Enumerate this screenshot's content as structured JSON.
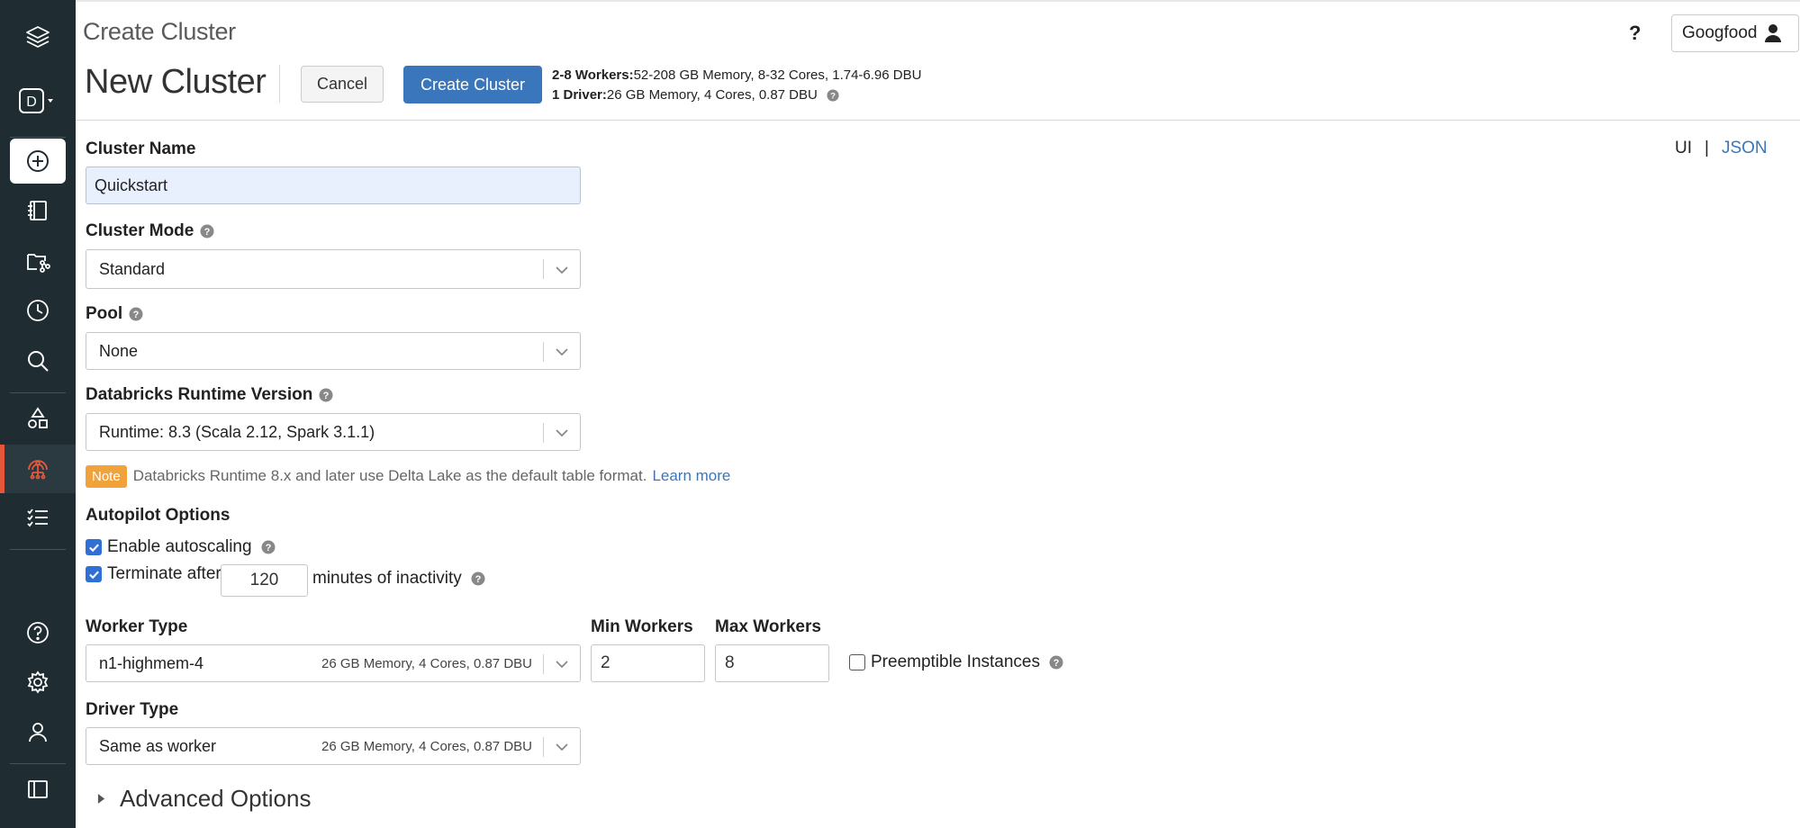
{
  "sidebar": {
    "workspace_letter": "D",
    "items": [
      {
        "name": "layers-logo-icon",
        "active": false
      },
      {
        "name": "create-icon",
        "active": false
      },
      {
        "name": "notebook-icon",
        "active": false
      },
      {
        "name": "repos-icon",
        "active": false
      },
      {
        "name": "recents-icon",
        "active": false
      },
      {
        "name": "search-icon",
        "active": false
      },
      {
        "name": "shapes-icon",
        "active": false
      },
      {
        "name": "compute-icon",
        "active": true
      },
      {
        "name": "jobs-icon",
        "active": false
      },
      {
        "name": "help-icon",
        "active": false
      },
      {
        "name": "settings-icon",
        "active": false
      },
      {
        "name": "account-icon",
        "active": false
      },
      {
        "name": "sidebar-toggle-icon",
        "active": false
      }
    ]
  },
  "header": {
    "breadcrumb": "Create Cluster",
    "title": "New Cluster",
    "cancel_label": "Cancel",
    "create_label": "Create Cluster",
    "summary_workers_bold": "2-8 Workers:",
    "summary_workers": "52-208 GB Memory, 8-32 Cores, 1.74-6.96 DBU",
    "summary_driver_bold": "1 Driver:",
    "summary_driver": "26 GB Memory, 4 Cores, 0.87 DBU",
    "help_label": "?",
    "user_name": "Googfood"
  },
  "view_toggle": {
    "ui": "UI",
    "separator": "|",
    "json": "JSON"
  },
  "form": {
    "cluster_name_label": "Cluster Name",
    "cluster_name_value": "Quickstart",
    "cluster_mode_label": "Cluster Mode",
    "cluster_mode_value": "Standard",
    "pool_label": "Pool",
    "pool_value": "None",
    "runtime_label": "Databricks Runtime Version",
    "runtime_value": "Runtime: 8.3 (Scala 2.12, Spark 3.1.1)",
    "note_badge": "Note",
    "note_text": "Databricks Runtime 8.x and later use Delta Lake as the default table format.",
    "note_link": "Learn more",
    "autopilot_label": "Autopilot Options",
    "autoscaling_label": "Enable autoscaling",
    "autoscaling_checked": true,
    "terminate_label": "Terminate after",
    "terminate_value": "120",
    "terminate_suffix": "minutes of inactivity",
    "terminate_checked": true,
    "worker_type_label": "Worker Type",
    "worker_type_value": "n1-highmem-4",
    "worker_type_meta": "26 GB Memory, 4 Cores, 0.87 DBU",
    "min_workers_label": "Min Workers",
    "min_workers_value": "2",
    "max_workers_label": "Max Workers",
    "max_workers_value": "8",
    "preemptible_label": "Preemptible Instances",
    "preemptible_checked": false,
    "driver_type_label": "Driver Type",
    "driver_type_value": "Same as worker",
    "driver_type_meta": "26 GB Memory, 4 Cores, 0.87 DBU",
    "advanced_label": "Advanced Options"
  },
  "colors": {
    "sidebar_bg": "#1f2d32",
    "primary": "#3a76bb",
    "active_marker": "#e4573b",
    "note": "#f0a33a"
  }
}
